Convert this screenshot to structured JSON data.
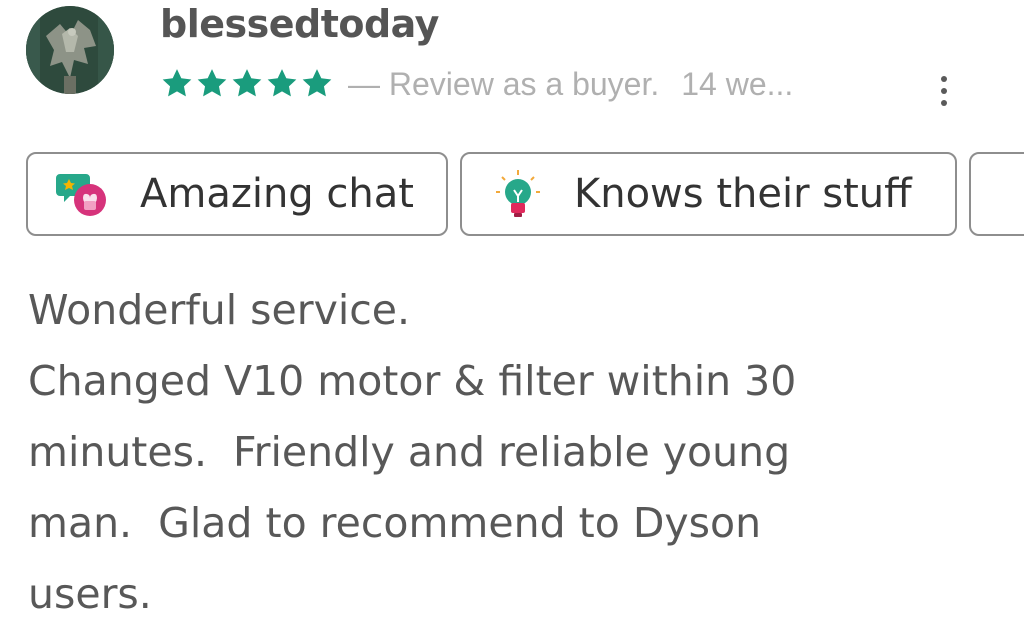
{
  "review": {
    "username": "blessedtoday",
    "rating": 5,
    "rating_max": 5,
    "star_color": "#1a9c7d",
    "meta_text": "— Review as a buyer.",
    "meta_date": "14 we...",
    "body": "Wonderful service.\nChanged V10 motor & filter within 30\nminutes.  Friendly and reliable young\nman.  Glad to recommend to Dyson\nusers."
  },
  "avatar": {
    "icon": "eagle-statue-avatar"
  },
  "menu": {
    "icon": "more-vertical-icon"
  },
  "tags": [
    {
      "label": "Amazing chat",
      "icon": "chat-heart-icon"
    },
    {
      "label": "Knows their stuff",
      "icon": "lightbulb-icon"
    },
    {
      "label": "",
      "icon": ""
    }
  ],
  "colors": {
    "accent_green": "#1a9c7d",
    "muted_text": "#b0b0b0",
    "body_text": "#585858",
    "chip_border": "#8e8e8e"
  }
}
